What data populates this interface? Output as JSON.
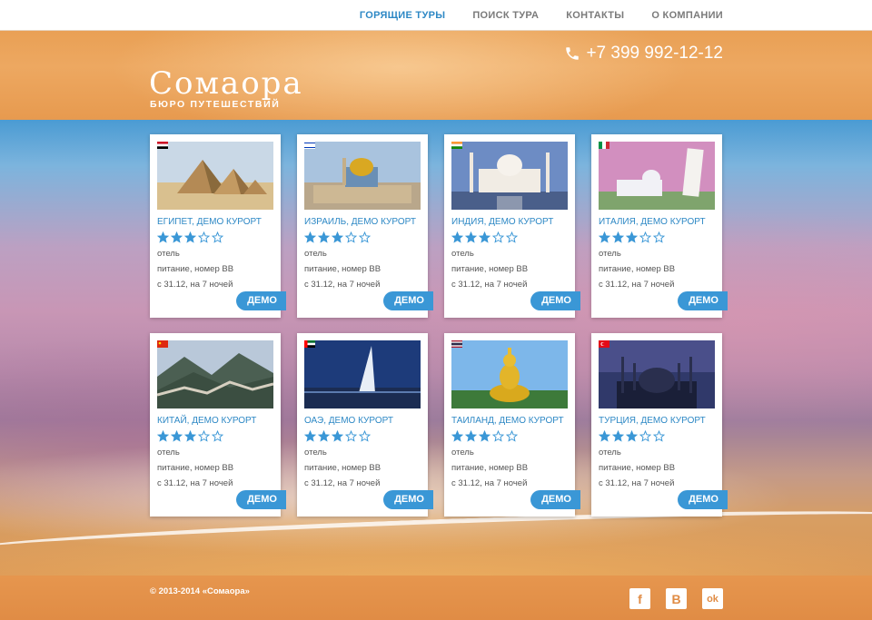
{
  "nav": {
    "items": [
      {
        "label": "ГОРЯЩИЕ ТУРЫ",
        "active": true
      },
      {
        "label": "ПОИСК ТУРА",
        "active": false
      },
      {
        "label": "КОНТАКТЫ",
        "active": false
      },
      {
        "label": "О КОМПАНИИ",
        "active": false
      }
    ]
  },
  "header": {
    "logo": "Сомаора",
    "logo_sub": "БЮРО ПУТЕШЕСТВИЙ",
    "phone": "+7 399 992-12-12",
    "phone_icon": "phone-icon"
  },
  "colors": {
    "accent": "#2d88c5",
    "button": "#3a97d6",
    "header_orange": "#e9a055",
    "footer_orange": "#e08c45"
  },
  "tours": [
    {
      "title": "ЕГИПЕТ, ДЕМО КУРОРТ",
      "rating": 3,
      "type": "отель",
      "meal": "питание, номер BB",
      "dates": "с 31.12, на 7 ночей",
      "button": "ДЕМО",
      "flag": "egypt",
      "image": "pyramids"
    },
    {
      "title": "ИЗРАИЛЬ, ДЕМО КУРОРТ",
      "rating": 3,
      "type": "отель",
      "meal": "питание, номер BB",
      "dates": "с 31.12, на 7 ночей",
      "button": "ДЕМО",
      "flag": "israel",
      "image": "jerusalem"
    },
    {
      "title": "ИНДИЯ, ДЕМО КУРОРТ",
      "rating": 3,
      "type": "отель",
      "meal": "питание, номер BB",
      "dates": "с 31.12, на 7 ночей",
      "button": "ДЕМО",
      "flag": "india",
      "image": "taj-mahal"
    },
    {
      "title": "ИТАЛИЯ, ДЕМО КУРОРТ",
      "rating": 3,
      "type": "отель",
      "meal": "питание, номер BB",
      "dates": "с 31.12, на 7 ночей",
      "button": "ДЕМО",
      "flag": "italy",
      "image": "pisa"
    },
    {
      "title": "КИТАЙ, ДЕМО КУРОРТ",
      "rating": 3,
      "type": "отель",
      "meal": "питание, номер BB",
      "dates": "с 31.12, на 7 ночей",
      "button": "ДЕМО",
      "flag": "china",
      "image": "great-wall"
    },
    {
      "title": "ОАЭ, ДЕМО КУРОРТ",
      "rating": 3,
      "type": "отель",
      "meal": "питание, номер BB",
      "dates": "с 31.12, на 7 ночей",
      "button": "ДЕМО",
      "flag": "uae",
      "image": "burj-al-arab"
    },
    {
      "title": "ТАИЛАНД, ДЕМО КУРОРТ",
      "rating": 3,
      "type": "отель",
      "meal": "питание, номер BB",
      "dates": "с 31.12, на 7 ночей",
      "button": "ДЕМО",
      "flag": "thailand",
      "image": "buddha"
    },
    {
      "title": "ТУРЦИЯ, ДЕМО КУРОРТ",
      "rating": 3,
      "type": "отель",
      "meal": "питание, номер BB",
      "dates": "с 31.12, на 7 ночей",
      "button": "ДЕМО",
      "flag": "turkey",
      "image": "mosque"
    }
  ],
  "footer": {
    "copyright": "© 2013-2014 «Сомаора»",
    "social": [
      {
        "icon": "facebook-icon",
        "glyph": "f"
      },
      {
        "icon": "vk-icon",
        "glyph": "В"
      },
      {
        "icon": "odnoklassniki-icon",
        "glyph": "ok"
      }
    ]
  }
}
